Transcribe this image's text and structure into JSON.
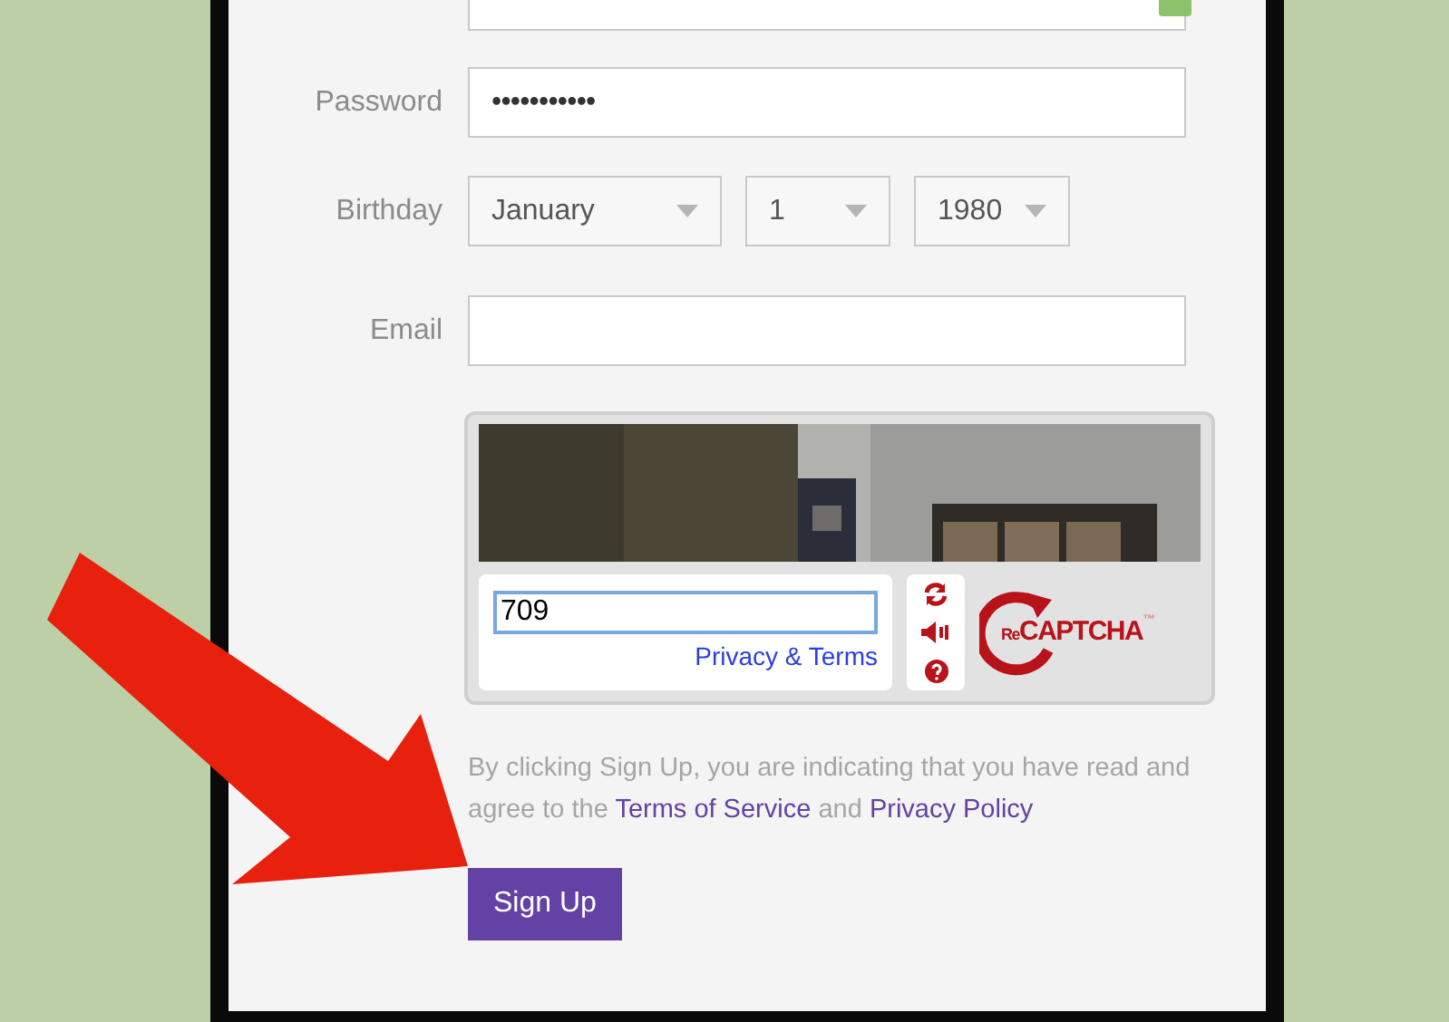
{
  "form": {
    "fields": [
      {
        "label": "Password",
        "kind": "password",
        "value": "•••••••••••"
      },
      {
        "label": "Birthday",
        "kind": "selects",
        "selects": [
          {
            "value": "January"
          },
          {
            "value": "1"
          },
          {
            "value": "1980"
          }
        ]
      },
      {
        "label": "Email",
        "kind": "text"
      }
    ]
  },
  "captcha": {
    "answer": "709",
    "privacy_link": "Privacy & Terms",
    "logo_prefix": "Re",
    "logo": "CAPTCHA",
    "logo_mark": "™"
  },
  "agreement": {
    "text": "By clicking Sign Up, you are indicating that you have read and agree to the",
    "terms_link": "Terms of Service",
    "joiner": "and",
    "privacy_link": "Privacy Policy"
  },
  "buttons": [
    {
      "label": "Sign Up"
    }
  ]
}
